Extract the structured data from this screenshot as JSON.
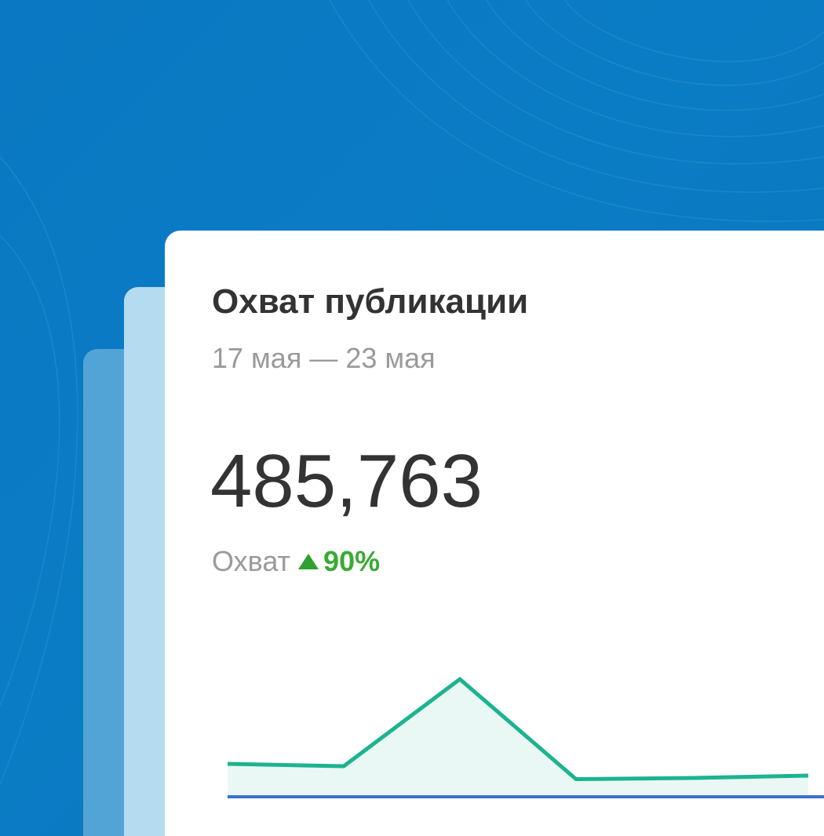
{
  "card": {
    "title": "Охват публикации",
    "date_range": "17 мая — 23 мая",
    "value": "485,763",
    "metric_label": "Охват",
    "change": "90%",
    "change_direction": "up-triangle-icon"
  },
  "colors": {
    "background": "#0a7bc4",
    "line": "#1db391",
    "area": "#e9f8f4",
    "baseline": "#3d6fd1",
    "positive": "#3aaa35"
  },
  "chart_data": {
    "type": "area",
    "title": "",
    "xlabel": "",
    "ylabel": "",
    "grid": false,
    "x": [
      1,
      2,
      3,
      4,
      5,
      6
    ],
    "series": [
      {
        "values": [
          28,
          26,
          100,
          15,
          16,
          18
        ]
      }
    ],
    "ylim": [
      0,
      120
    ]
  }
}
